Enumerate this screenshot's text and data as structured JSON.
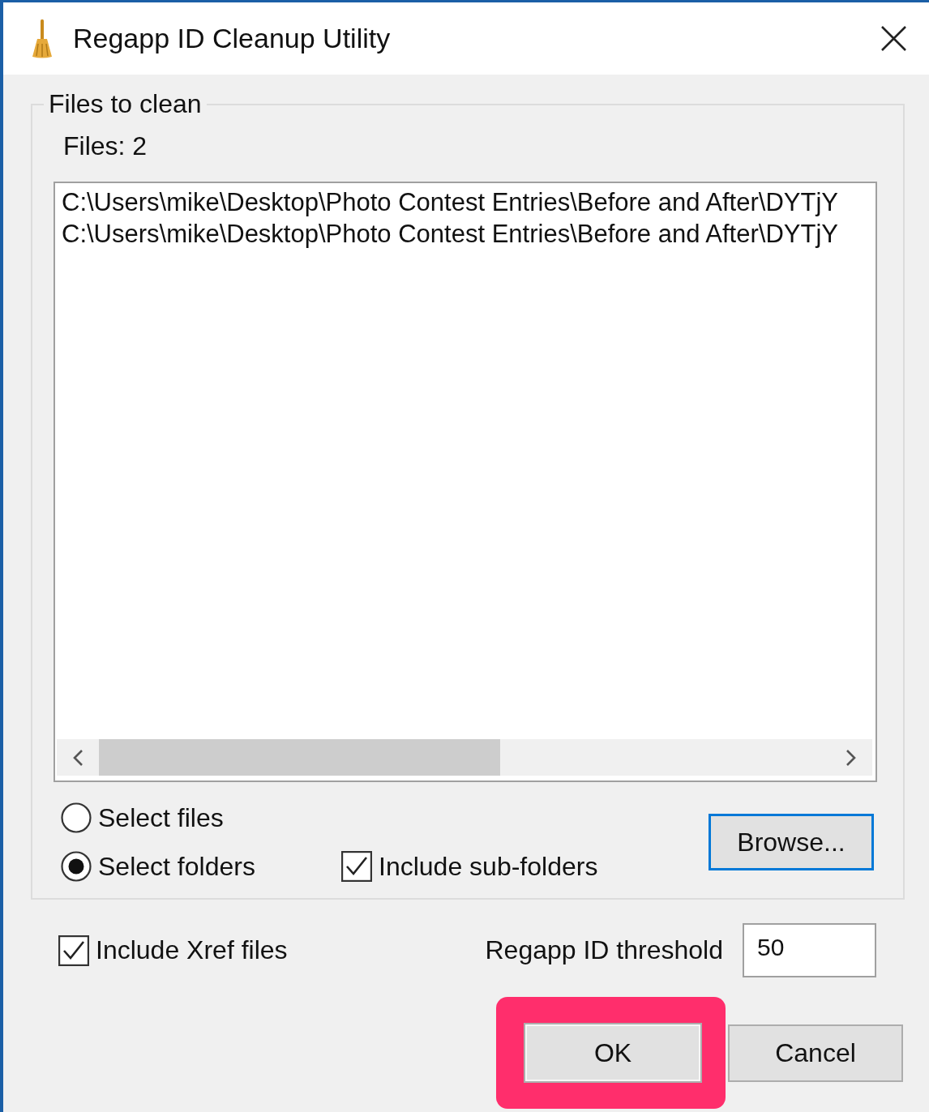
{
  "window": {
    "title": "Regapp ID Cleanup Utility"
  },
  "files_group": {
    "legend": "Files to clean",
    "count": "Files: 2",
    "files": [
      "C:\\Users\\mike\\Desktop\\Photo Contest Entries\\Before and After\\DYTjY",
      "C:\\Users\\mike\\Desktop\\Photo Contest Entries\\Before and After\\DYTjY"
    ],
    "mode_options": [
      {
        "label": "Select files",
        "selected": false
      },
      {
        "label": "Select folders",
        "selected": true
      }
    ],
    "include_subfolders": {
      "label": "Include sub-folders",
      "checked": true
    },
    "browse_button": {
      "label": "Browse...",
      "focused": true
    }
  },
  "include_xref": {
    "label": "Include Xref files",
    "checked": true
  },
  "threshold": {
    "label": "Regapp ID threshold",
    "value": "50"
  },
  "buttons": [
    {
      "label": "OK",
      "highlighted": true
    },
    {
      "label": "Cancel",
      "highlighted": false
    }
  ]
}
